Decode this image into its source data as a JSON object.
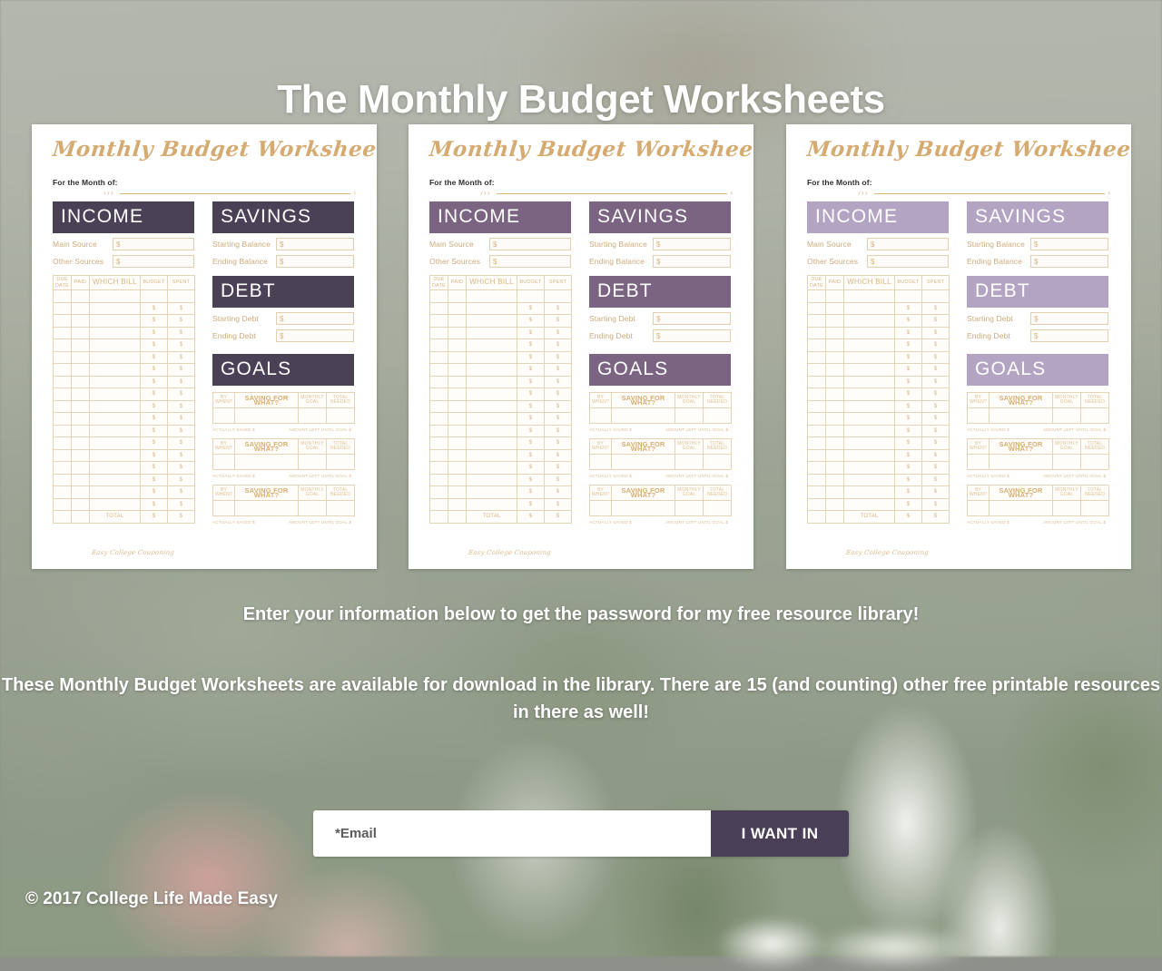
{
  "page": {
    "hero_title": "The Monthly Budget Worksheets",
    "copyright": "© 2017 College Life Made Easy"
  },
  "copy": {
    "paragraph1": "Enter your information below to get the password for my free resource library!",
    "paragraph2": "These Monthly Budget Worksheets are available for download in the library. There are 15 (and counting) other free printable resources in there as well!"
  },
  "form": {
    "email_placeholder": "*Email",
    "email_value": "",
    "submit_label": "I WANT IN"
  },
  "worksheet": {
    "title": "Monthly Budget Worksheet",
    "month_label": "For the Month of:",
    "credit": "Easy College Couponing",
    "sections": {
      "income": "INCOME",
      "savings": "SAVINGS",
      "debt": "DEBT",
      "goals": "GOALS"
    },
    "income_fields": [
      {
        "label": "Main Source",
        "value": "$"
      },
      {
        "label": "Other Sources",
        "value": "$"
      }
    ],
    "savings_fields": [
      {
        "label": "Starting Balance",
        "value": "$"
      },
      {
        "label": "Ending Balance",
        "value": "$"
      }
    ],
    "debt_fields": [
      {
        "label": "Starting Debt",
        "value": "$"
      },
      {
        "label": "Ending Debt",
        "value": "$"
      }
    ],
    "bills_table": {
      "headers": [
        "DUE DATE",
        "PAID",
        "WHICH BILL",
        "BUDGET",
        "SPENT"
      ],
      "row_count": 18,
      "money_symbol": "$",
      "total_label": "TOTAL"
    },
    "goals_table": {
      "headers": [
        "BY WHEN?",
        "SAVING FOR WHAT?",
        "MONTHLY GOAL",
        "TOTAL NEEDED"
      ],
      "note_left": "ACTUALLY SAVED  $",
      "note_right": "AMOUNT LEFT UNTIL GOAL  $",
      "block_count": 3
    }
  },
  "variants": [
    {
      "name": "dark-purple",
      "accent": "#4a4156"
    },
    {
      "name": "medium-purple",
      "accent": "#7b6482"
    },
    {
      "name": "light-purple",
      "accent": "#b3a4c3"
    }
  ],
  "colors": {
    "gold": "#d6ab72",
    "gold_light": "#e6d4b6",
    "button": "#493f56",
    "text_white": "#ffffff"
  }
}
